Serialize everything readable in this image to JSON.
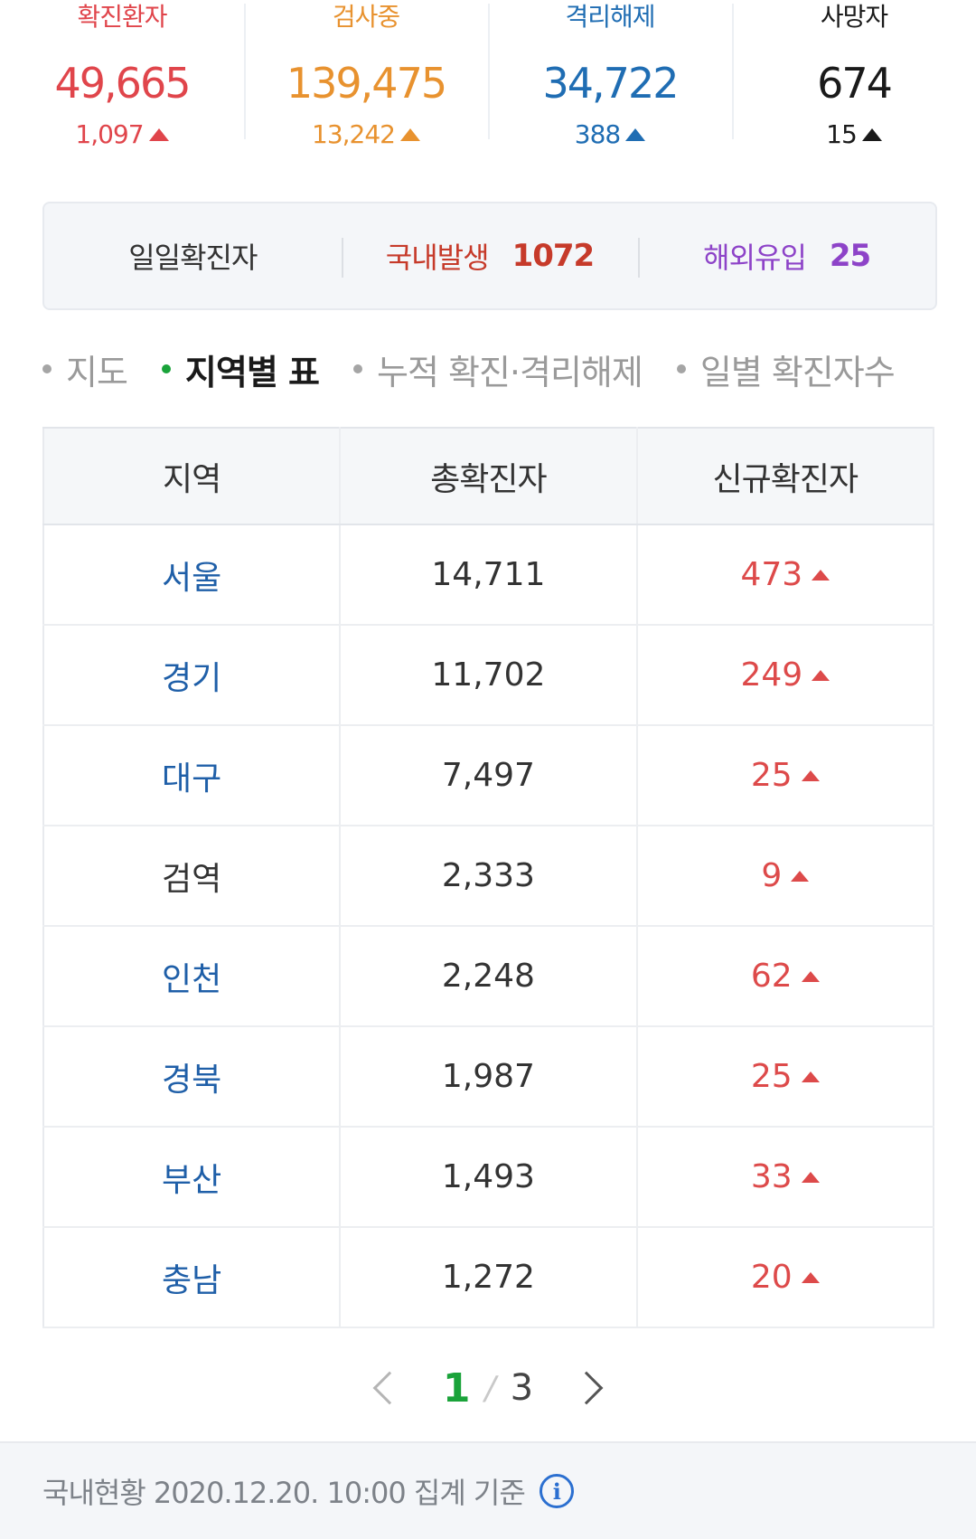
{
  "stats": [
    {
      "label": "확진환자",
      "value": "49,665",
      "delta": "1,097",
      "color": "#e0454b"
    },
    {
      "label": "검사중",
      "value": "139,475",
      "delta": "13,242",
      "color": "#e8922f"
    },
    {
      "label": "격리해제",
      "value": "34,722",
      "delta": "388",
      "color": "#1f6db3"
    },
    {
      "label": "사망자",
      "value": "674",
      "delta": "15",
      "color": "#1a1a1a"
    }
  ],
  "daily": {
    "title": "일일확진자",
    "domestic_label": "국내발생",
    "domestic_value": "1072",
    "overseas_label": "해외유입",
    "overseas_value": "25"
  },
  "tabs": [
    {
      "label": "지도",
      "active": false
    },
    {
      "label": "지역별 표",
      "active": true
    },
    {
      "label": "누적 확진·격리해제",
      "active": false
    },
    {
      "label": "일별 확진자수",
      "active": false
    }
  ],
  "table": {
    "headers": [
      "지역",
      "총확진자",
      "신규확진자"
    ],
    "rows": [
      {
        "region": "서울",
        "total": "14,711",
        "new": "473",
        "link": true
      },
      {
        "region": "경기",
        "total": "11,702",
        "new": "249",
        "link": true
      },
      {
        "region": "대구",
        "total": "7,497",
        "new": "25",
        "link": true
      },
      {
        "region": "검역",
        "total": "2,333",
        "new": "9",
        "link": false
      },
      {
        "region": "인천",
        "total": "2,248",
        "new": "62",
        "link": true
      },
      {
        "region": "경북",
        "total": "1,987",
        "new": "25",
        "link": true
      },
      {
        "region": "부산",
        "total": "1,493",
        "new": "33",
        "link": true
      },
      {
        "region": "충남",
        "total": "1,272",
        "new": "20",
        "link": true
      }
    ]
  },
  "pagination": {
    "current": "1",
    "separator": "/",
    "total": "3"
  },
  "footer": {
    "text": "국내현황 2020.12.20. 10:00 집계 기준",
    "info_icon": "info-icon"
  }
}
